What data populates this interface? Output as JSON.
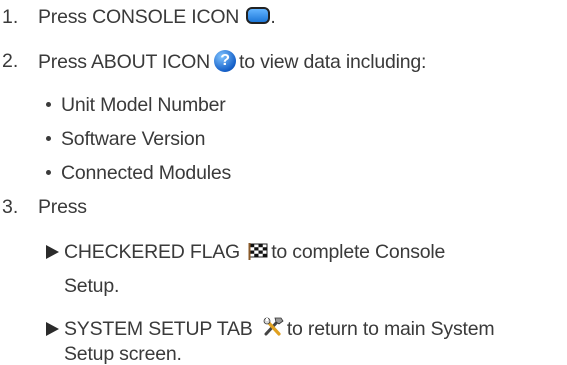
{
  "steps": [
    {
      "number": "1.",
      "text": "Press CONSOLE ICON",
      "icon": "console-icon",
      "suffix": "."
    },
    {
      "number": "2.",
      "text": "Press ABOUT ICON",
      "icon": "about-icon",
      "after": "to view data including:",
      "bullets": [
        "Unit Model Number",
        "Software Version",
        "Connected Modules"
      ]
    },
    {
      "number": "3.",
      "text": "Press",
      "sub_items": [
        {
          "label": "CHECKERED FLAG",
          "icon": "checkered-flag-icon",
          "after": "to complete Console",
          "continuation": "Setup."
        },
        {
          "label": "SYSTEM SETUP TAB",
          "icon": "system-setup-tools-icon",
          "after": "to return to main System",
          "continuation": "Setup screen."
        }
      ]
    }
  ],
  "colors": {
    "text": "#3a3a3a",
    "console_icon_fill": "#3a8ff0",
    "about_icon_fill": "#1e6fd8"
  },
  "icons": {
    "about_glyph": "?"
  }
}
